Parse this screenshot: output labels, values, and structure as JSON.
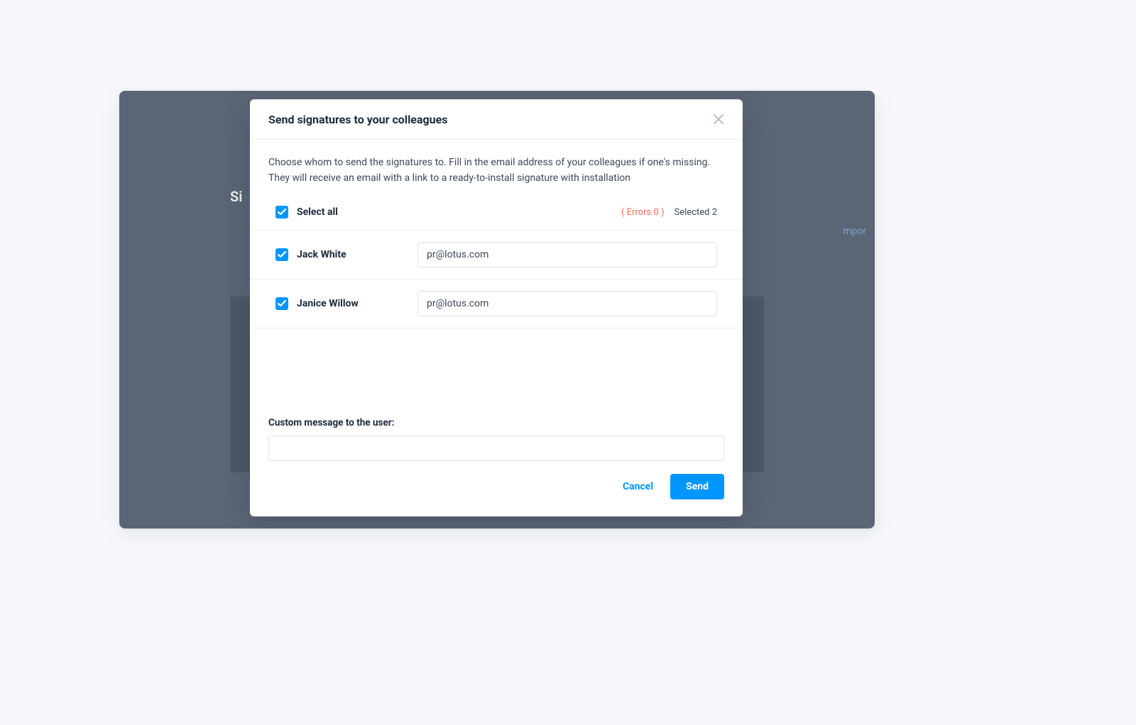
{
  "modal": {
    "title": "Send signatures to your colleagues",
    "description": "Choose whom to send the signatures to. Fill in the email address of your colleagues if one's missing. They will receive an email with a link to a ready-to-install signature with installation",
    "select_all_label": "Select all",
    "errors_label": "( Errors 0 )",
    "selected_label": "Selected 2",
    "recipients": [
      {
        "name": "Jack White",
        "email": "pr@lotus.com"
      },
      {
        "name": "Janice Willow",
        "email": "pr@lotus.com"
      }
    ],
    "custom_msg_label": "Custom message to the user:",
    "custom_msg_value": "",
    "cancel_label": "Cancel",
    "send_label": "Send"
  },
  "background": {
    "sidebar_fragment": "Si",
    "tag_fragment": "mpor"
  },
  "colors": {
    "accent": "#0096ff",
    "error": "#ff6a55"
  }
}
